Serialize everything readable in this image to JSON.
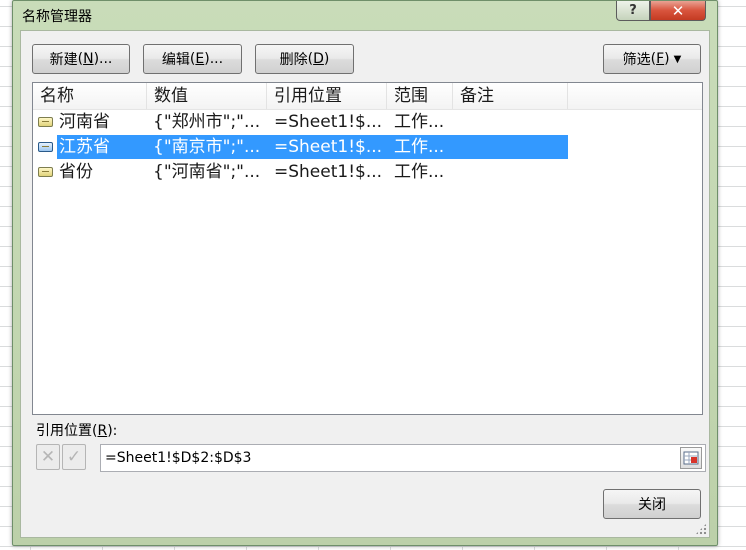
{
  "dialog": {
    "title": "名称管理器",
    "help_label": "?",
    "close_label": "✕"
  },
  "toolbar": {
    "new_label": "新建",
    "new_key": "N",
    "new_suffix": ")...",
    "edit_label": "编辑",
    "edit_key": "E",
    "edit_suffix": ")...",
    "delete_label": "删除",
    "delete_key": "D",
    "delete_suffix": ")",
    "filter_label": "筛选",
    "filter_key": "F",
    "filter_suffix": ")",
    "filter_arrow": "▼"
  },
  "list": {
    "columns": [
      "名称",
      "数值",
      "引用位置",
      "范围",
      "备注"
    ],
    "rows": [
      {
        "name": "河南省",
        "value": "{\"郑州市\";\"...",
        "refers_to": "=Sheet1!$...",
        "scope": "工作...",
        "comment": "",
        "selected": false
      },
      {
        "name": "江苏省",
        "value": "{\"南京市\";\"...",
        "refers_to": "=Sheet1!$...",
        "scope": "工作...",
        "comment": "",
        "selected": true
      },
      {
        "name": "省份",
        "value": "{\"河南省\";\"...",
        "refers_to": "=Sheet1!$...",
        "scope": "工作...",
        "comment": "",
        "selected": false
      }
    ]
  },
  "refers_to": {
    "label": "引用位置",
    "key": "R",
    "label_suffix": "):",
    "value": "=Sheet1!$D$2:$D$3",
    "cancel_icon": "✕",
    "confirm_icon": "✓"
  },
  "footer": {
    "close_label": "关闭"
  }
}
